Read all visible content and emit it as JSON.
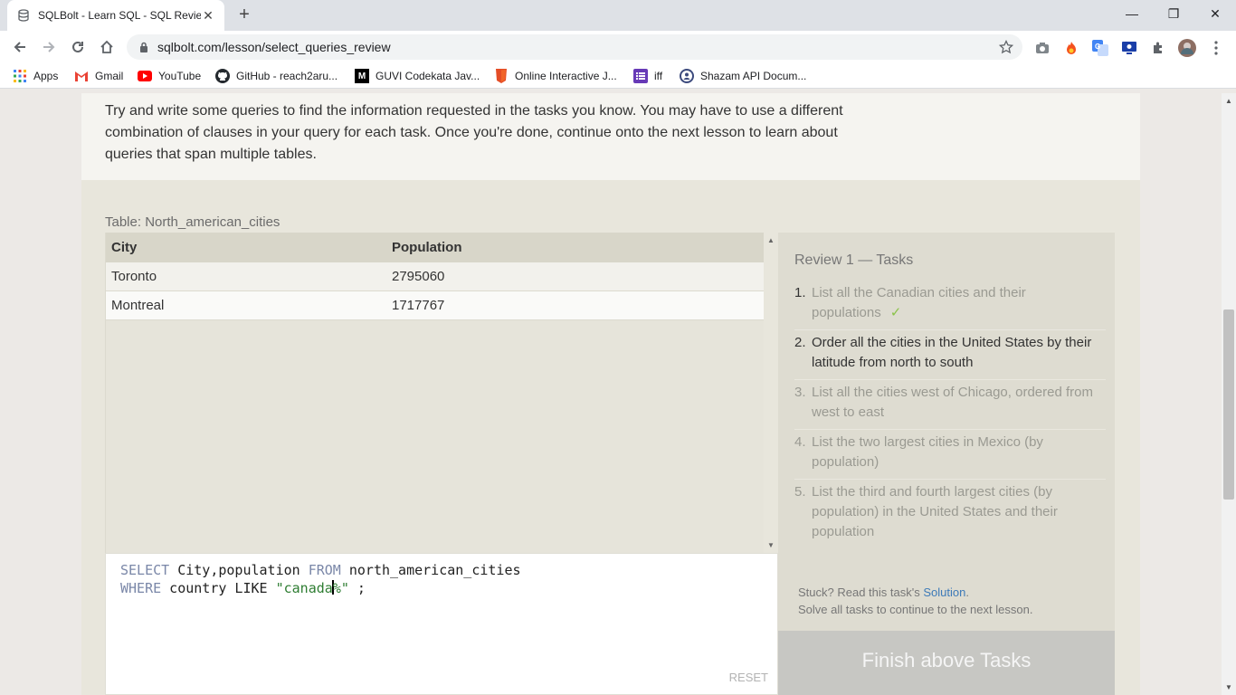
{
  "browser": {
    "tab_title": "SQLBolt - Learn SQL - SQL Review",
    "url": "sqlbolt.com/lesson/select_queries_review",
    "bookmarks": [
      {
        "label": "Apps",
        "icon": "apps-grid-icon"
      },
      {
        "label": "Gmail",
        "icon": "gmail-icon"
      },
      {
        "label": "YouTube",
        "icon": "youtube-icon"
      },
      {
        "label": "GitHub - reach2aru...",
        "icon": "github-icon"
      },
      {
        "label": "GUVI Codekata Jav...",
        "icon": "medium-icon"
      },
      {
        "label": "Online Interactive J...",
        "icon": "html5-icon"
      },
      {
        "label": "iff",
        "icon": "forms-icon"
      },
      {
        "label": "Shazam API Docum...",
        "icon": "shazam-icon"
      }
    ]
  },
  "lesson": {
    "intro": "Try and write some queries to find the information requested in the tasks you know. You may have to use a different combination of clauses in your query for each task. Once you're done, continue onto the next lesson to learn about queries that span multiple tables.",
    "table_label": "Table: North_american_cities",
    "columns": [
      "City",
      "Population"
    ],
    "rows": [
      {
        "city": "Toronto",
        "population": "2795060"
      },
      {
        "city": "Montreal",
        "population": "1717767"
      }
    ],
    "query": {
      "line1": {
        "kw1": "SELECT",
        "t1": " City,population ",
        "kw2": "FROM",
        "t2": " north_american_cities"
      },
      "line2": {
        "kw1": "WHERE",
        "t1": " country LIKE ",
        "str_a": "\"canada",
        "str_b": "%\"",
        "t2": " ;"
      }
    },
    "reset_label": "RESET"
  },
  "tasks": {
    "title": "Review 1 — Tasks",
    "items": [
      {
        "num": "1.",
        "text": "List all the Canadian cities and their populations",
        "state": "done"
      },
      {
        "num": "2.",
        "text": "Order all the cities in the United States by their latitude from north to south",
        "state": "current"
      },
      {
        "num": "3.",
        "text": "List all the cities west of Chicago, ordered from west to east",
        "state": "pending"
      },
      {
        "num": "4.",
        "text": "List the two largest cities in Mexico (by population)",
        "state": "pending"
      },
      {
        "num": "5.",
        "text": "List the third and fourth largest cities (by population) in the United States and their population",
        "state": "pending"
      }
    ],
    "stuck_prefix": "Stuck? Read this task's ",
    "solution_link": "Solution",
    "stuck_suffix": ".",
    "solve_all": "Solve all tasks to continue to the next lesson.",
    "finish_label": "Finish above Tasks"
  },
  "colors": {
    "check": "#8bc34a",
    "link": "#3d7ab8",
    "finish_bg": "#c7c7c3"
  }
}
